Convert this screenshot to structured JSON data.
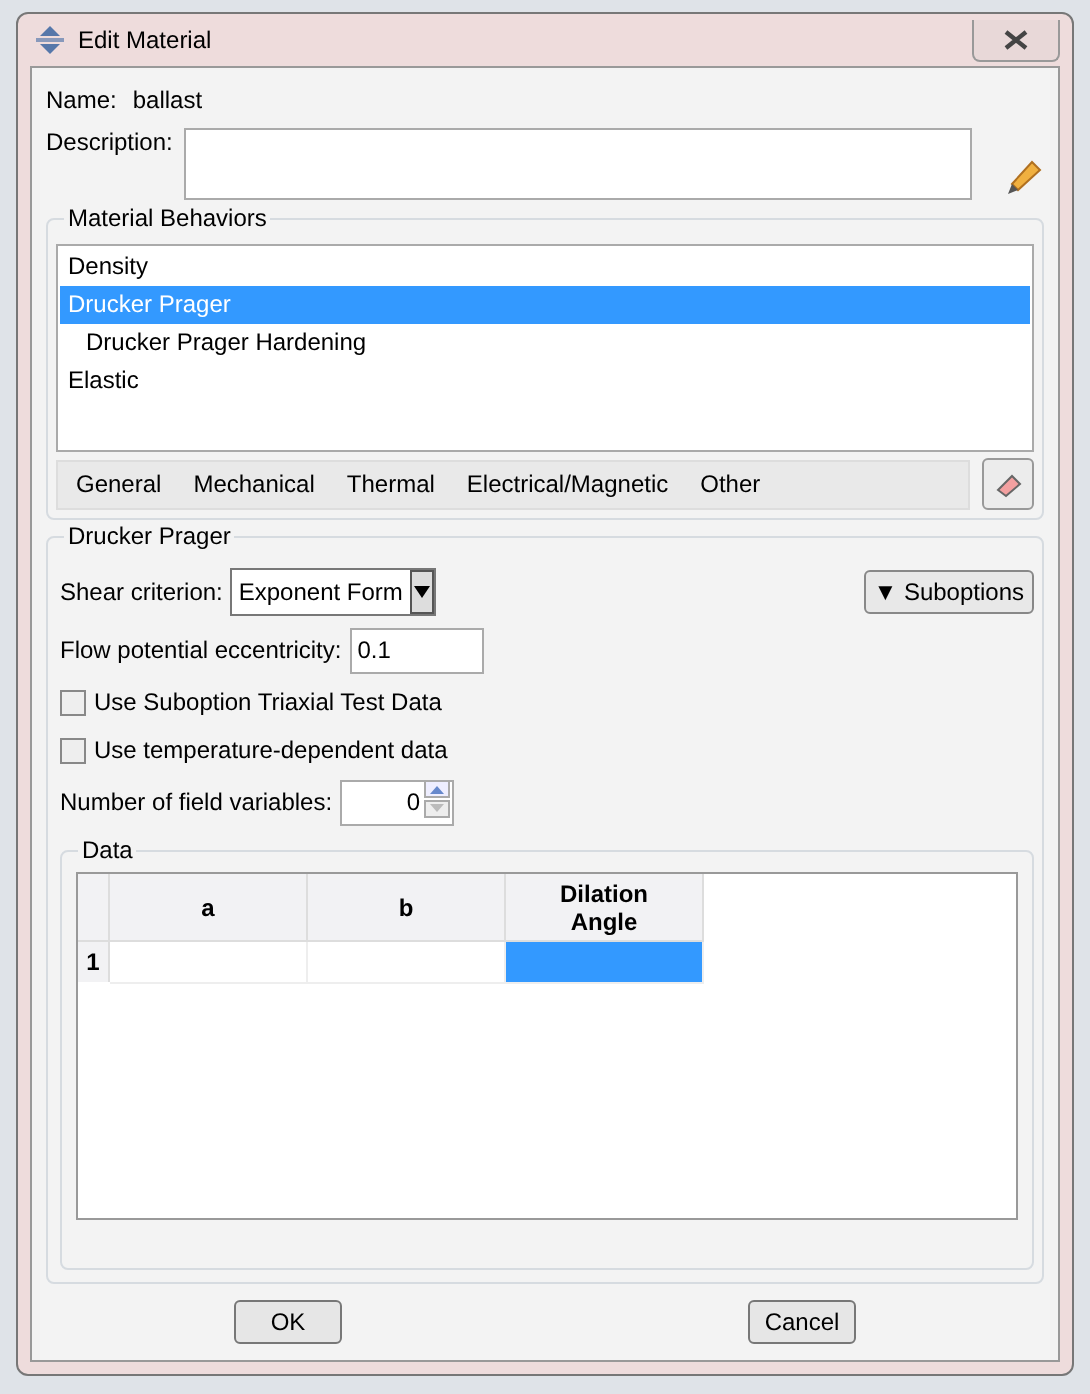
{
  "window": {
    "title": "Edit Material"
  },
  "name": {
    "label": "Name:",
    "value": "ballast"
  },
  "description": {
    "label": "Description:"
  },
  "behaviors": {
    "title": "Material Behaviors",
    "items": [
      {
        "label": "Density",
        "selected": false
      },
      {
        "label": "Drucker Prager",
        "selected": true,
        "children": [
          {
            "label": "Drucker Prager Hardening",
            "selected": false
          }
        ]
      },
      {
        "label": "Elastic",
        "selected": false
      }
    ],
    "menus": [
      "General",
      "Mechanical",
      "Thermal",
      "Electrical/Magnetic",
      "Other"
    ]
  },
  "section": {
    "title": "Drucker Prager",
    "shear_criterion": {
      "label": "Shear criterion:",
      "value": "Exponent Form"
    },
    "suboptions": {
      "label": "Suboptions",
      "arrow": "▼"
    },
    "flow_potential": {
      "label": "Flow potential eccentricity:",
      "value": "0.1"
    },
    "checkboxes": [
      {
        "label": "Use Suboption Triaxial Test Data",
        "checked": false
      },
      {
        "label": "Use temperature-dependent data",
        "checked": false
      }
    ],
    "field_variables": {
      "label": "Number of field variables:",
      "value": "0"
    },
    "data": {
      "title": "Data",
      "columns": [
        "a",
        "b",
        "Dilation\nAngle"
      ],
      "rows": [
        {
          "number": "1",
          "cells": [
            {
              "selected": false
            },
            {
              "selected": false
            },
            {
              "selected": true
            }
          ]
        }
      ]
    }
  },
  "buttons": [
    "OK",
    "Cancel"
  ]
}
